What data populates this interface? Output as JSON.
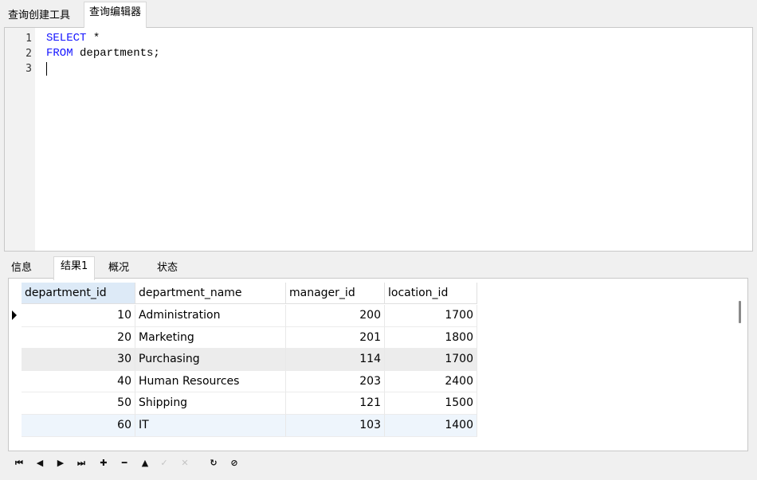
{
  "top_tabs": [
    "查询创建工具",
    "查询编辑器"
  ],
  "editor": {
    "line_numbers": [
      "1",
      "2",
      "3"
    ],
    "lines": [
      {
        "kw": "SELECT",
        "rest": " *"
      },
      {
        "kw": "FROM",
        "rest": " departments;"
      }
    ]
  },
  "result_tabs": [
    "信息",
    "结果1",
    "概况",
    "状态"
  ],
  "grid": {
    "columns": [
      "department_id",
      "department_name",
      "manager_id",
      "location_id"
    ],
    "rows": [
      [
        "10",
        "Administration",
        "200",
        "1700"
      ],
      [
        "20",
        "Marketing",
        "201",
        "1800"
      ],
      [
        "30",
        "Purchasing",
        "114",
        "1700"
      ],
      [
        "40",
        "Human Resources",
        "203",
        "2400"
      ],
      [
        "50",
        "Shipping",
        "121",
        "1500"
      ],
      [
        "60",
        "IT",
        "103",
        "1400"
      ]
    ]
  },
  "nav": {
    "first": "⏮",
    "prev": "◀",
    "next": "▶",
    "last": "⏭",
    "add": "✚",
    "delete": "━",
    "up": "▲",
    "apply": "✓",
    "discard": "✕",
    "refresh": "↻",
    "stop": "⊘"
  }
}
